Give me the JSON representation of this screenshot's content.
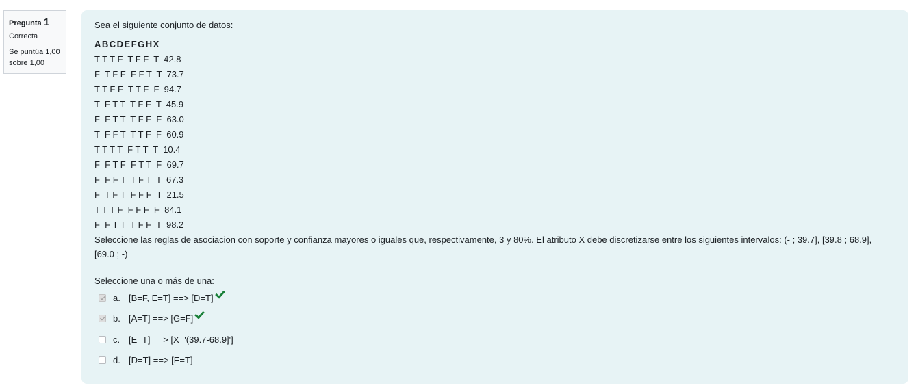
{
  "info": {
    "question_label": "Pregunta",
    "question_number": "1",
    "state": "Correcta",
    "grade_line1": "Se puntúa 1,00",
    "grade_line2": "sobre 1,00"
  },
  "question": {
    "intro": "Sea el siguiente conjunto de datos:",
    "header": "ABCDEFGHX",
    "rows": [
      "T T T F  T F F  T  42.8",
      "F  T F F  F F T  T  73.7",
      "T T F F  T T F  F  94.7",
      "T  F T T  T F F  T  45.9",
      "F  F T T  T F F  F  63.0",
      "T  F F T  T T F  F  60.9",
      "T T T T  F T T  T  10.4",
      "F  F T F  F T T  F  69.7",
      "F  F F T  T F T  T  67.3",
      "F  T F T  F F F  T  21.5",
      "T T T F  F F F  F  84.1",
      "F  F T T  T F F  T  98.2"
    ],
    "instructions": "Seleccione las reglas de asociacion con soporte y confianza mayores o iguales que, respectivamente, 3 y 80%. El atributo X debe discretizarse entre los siguientes intervalos: (- ; 39.7], [39.8 ; 68.9], [69.0 ; -)",
    "prompt": "Seleccione una o más de una:",
    "answers": [
      {
        "letter": "a.",
        "text": "[B=F, E=T] ==> [D=T]",
        "checked": true,
        "correct": true
      },
      {
        "letter": "b.",
        "text": "[A=T] ==> [G=F]",
        "checked": true,
        "correct": true
      },
      {
        "letter": "c.",
        "text": "[E=T] ==> [X='(39.7-68.9]']",
        "checked": false,
        "correct": false
      },
      {
        "letter": "d.",
        "text": "[D=T] ==> [E=T]",
        "checked": false,
        "correct": false
      }
    ]
  },
  "colors": {
    "panel_bg": "#e7f3f5",
    "info_bg": "#f8f9fa",
    "correct_tick": "#198038"
  },
  "icons": {
    "correct": "check-icon"
  }
}
